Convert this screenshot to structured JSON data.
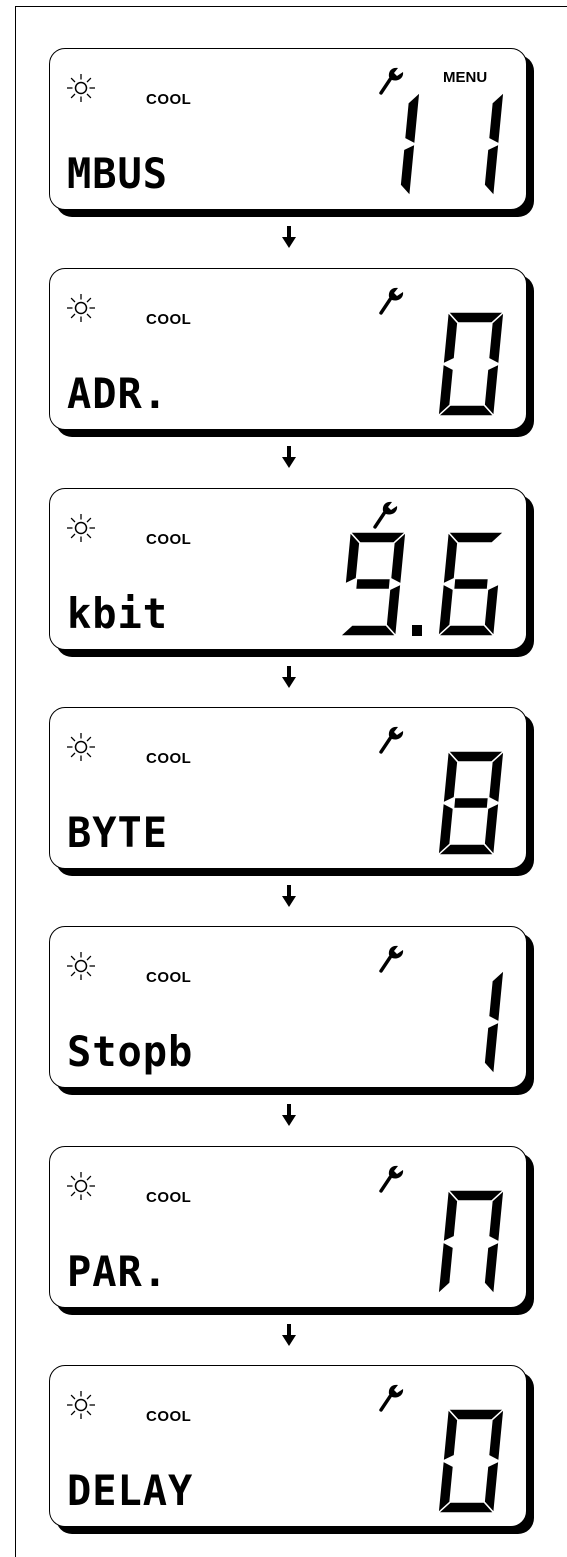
{
  "arrow_icon": "down-arrow-icon",
  "screens": [
    {
      "mode": "COOL",
      "menu": "MENU",
      "label": "MBUS",
      "value": "11",
      "icons": [
        "sun-icon",
        "wrench-icon"
      ]
    },
    {
      "mode": "COOL",
      "menu": "",
      "label": "ADR.",
      "value": "0",
      "icons": [
        "sun-icon",
        "wrench-icon"
      ]
    },
    {
      "mode": "COOL",
      "menu": "",
      "label": "kbit",
      "value": "9.6",
      "icons": [
        "sun-icon",
        "wrench-icon"
      ]
    },
    {
      "mode": "COOL",
      "menu": "",
      "label": "BYTE",
      "value": "8",
      "icons": [
        "sun-icon",
        "wrench-icon"
      ]
    },
    {
      "mode": "COOL",
      "menu": "",
      "label": "Stopb",
      "value": "1",
      "icons": [
        "sun-icon",
        "wrench-icon"
      ]
    },
    {
      "mode": "COOL",
      "menu": "",
      "label": "PAR.",
      "value": "n",
      "icons": [
        "sun-icon",
        "wrench-icon"
      ]
    },
    {
      "mode": "COOL",
      "menu": "",
      "label": "DELAY",
      "value": "0",
      "icons": [
        "sun-icon",
        "wrench-icon"
      ]
    }
  ]
}
